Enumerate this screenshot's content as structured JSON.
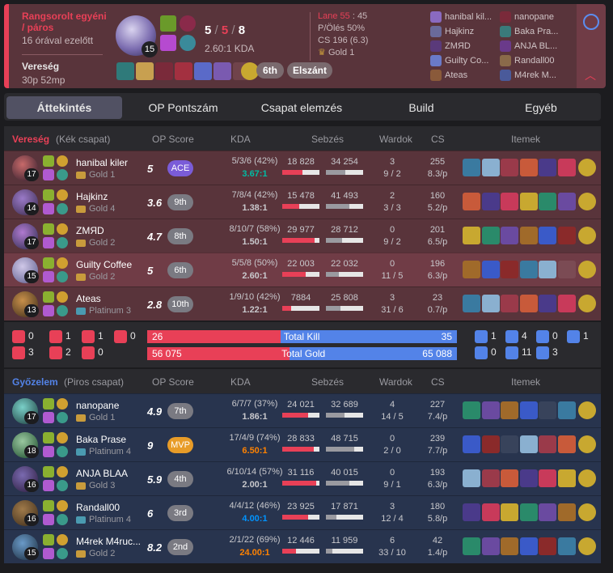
{
  "match": {
    "mode": "Rangsorolt egyéni / páros",
    "ago": "16 órával ezelőtt",
    "result": "Vereség",
    "length": "30p 52mp",
    "champ_level": "15",
    "kills": "5",
    "deaths": "5",
    "assists": "8",
    "kda_ratio": "2.60:1 KDA",
    "lane": "Lane 55",
    "lane_value": ": 45",
    "kp": "P/Ölés 50%",
    "cs": "CS 196 (6.3)",
    "rank": "Gold 1",
    "place_badge": "6th",
    "tag_badge": "Elszánt",
    "blue_players": [
      "hanibal kil...",
      "Hajkinz",
      "ZMЯD",
      "Guilty Co...",
      "Ateas"
    ],
    "red_players": [
      "nanopane",
      "Baka Pra...",
      "ANJA BL...",
      "Randall00",
      "M4rek M..."
    ]
  },
  "tabs": [
    "Áttekintés",
    "OP Pontszám",
    "Csapat elemzés",
    "Build",
    "Egyéb"
  ],
  "headers": {
    "op": "OP Score",
    "kda": "KDA",
    "dmg": "Sebzés",
    "ward": "Wardok",
    "cs": "CS",
    "items": "Itemek"
  },
  "teams": [
    {
      "result": "Vereség",
      "label": "(Kék csapat)",
      "result_color": "#e84057",
      "players": [
        {
          "name": "hanibal kiler",
          "tier": "Gold 1",
          "level": "17",
          "op": "5",
          "badge": "ACE",
          "kda": "5/3/6 (42%)",
          "ratio": "3.67:1",
          "dmg": "18 828",
          "taken": "34 254",
          "dmg_frac": 0.55,
          "taken_frac": 0.53,
          "ward": "3",
          "ward2": "9 / 2",
          "cs": "255",
          "cspm": "8.3/p"
        },
        {
          "name": "Hajkinz",
          "tier": "Gold 4",
          "level": "14",
          "op": "3.6",
          "badge": "9th",
          "kda": "7/8/4 (42%)",
          "ratio": "1.38:1",
          "dmg": "15 478",
          "taken": "41 493",
          "dmg_frac": 0.45,
          "taken_frac": 0.64,
          "ward": "2",
          "ward2": "3 / 3",
          "cs": "160",
          "cspm": "5.2/p"
        },
        {
          "name": "ZMЯD",
          "tier": "Gold 2",
          "level": "17",
          "op": "4.7",
          "badge": "8th",
          "kda": "8/10/7 (58%)",
          "ratio": "1.50:1",
          "dmg": "29 977",
          "taken": "28 712",
          "dmg_frac": 0.88,
          "taken_frac": 0.44,
          "ward": "0",
          "ward2": "9 / 2",
          "cs": "201",
          "cspm": "6.5/p"
        },
        {
          "name": "Guilty Coffee",
          "tier": "Gold 2",
          "level": "15",
          "op": "5",
          "badge": "6th",
          "kda": "5/5/8 (50%)",
          "ratio": "2.60:1",
          "dmg": "22 003",
          "taken": "22 032",
          "dmg_frac": 0.64,
          "taken_frac": 0.34,
          "ward": "0",
          "ward2": "11 / 5",
          "cs": "196",
          "cspm": "6.3/p"
        },
        {
          "name": "Ateas",
          "tier": "Platinum 3",
          "level": "13",
          "op": "2.8",
          "badge": "10th",
          "kda": "1/9/10 (42%)",
          "ratio": "1.22:1",
          "dmg": "7884",
          "taken": "25 808",
          "dmg_frac": 0.23,
          "taken_frac": 0.4,
          "ward": "3",
          "ward2": "31 / 6",
          "cs": "23",
          "cspm": "0.7/p"
        }
      ]
    },
    {
      "result": "Győzelem",
      "label": "(Piros csapat)",
      "result_color": "#5383e8",
      "players": [
        {
          "name": "nanopane",
          "tier": "Gold 1",
          "level": "17",
          "op": "4.9",
          "badge": "7th",
          "kda": "6/7/7 (37%)",
          "ratio": "1.86:1",
          "dmg": "24 021",
          "taken": "32 689",
          "dmg_frac": 0.7,
          "taken_frac": 0.5,
          "ward": "4",
          "ward2": "14 / 5",
          "cs": "227",
          "cspm": "7.4/p"
        },
        {
          "name": "Baka Prase",
          "tier": "Platinum 4",
          "level": "18",
          "op": "9",
          "badge": "MVP",
          "kda": "17/4/9 (74%)",
          "ratio": "6.50:1",
          "dmg": "28 833",
          "taken": "48 715",
          "dmg_frac": 0.84,
          "taken_frac": 0.75,
          "ward": "0",
          "ward2": "2 / 0",
          "cs": "239",
          "cspm": "7.7/p"
        },
        {
          "name": "ANJA BLAA",
          "tier": "Gold 3",
          "level": "16",
          "op": "5.9",
          "badge": "4th",
          "kda": "6/10/14 (57%)",
          "ratio": "2.00:1",
          "dmg": "31 116",
          "taken": "40 015",
          "dmg_frac": 0.91,
          "taken_frac": 0.62,
          "ward": "0",
          "ward2": "9 / 1",
          "cs": "193",
          "cspm": "6.3/p"
        },
        {
          "name": "Randall00",
          "tier": "Platinum 4",
          "level": "16",
          "op": "6",
          "badge": "3rd",
          "kda": "4/4/12 (46%)",
          "ratio": "4.00:1",
          "dmg": "23 925",
          "taken": "17 871",
          "dmg_frac": 0.7,
          "taken_frac": 0.28,
          "ward": "3",
          "ward2": "12 / 4",
          "cs": "180",
          "cspm": "5.8/p"
        },
        {
          "name": "M4rek M4ruc...",
          "tier": "Gold 2",
          "level": "15",
          "op": "8.2",
          "badge": "2nd",
          "kda": "2/1/22 (69%)",
          "ratio": "24.00:1",
          "dmg": "12 446",
          "taken": "11 959",
          "dmg_frac": 0.36,
          "taken_frac": 0.18,
          "ward": "6",
          "ward2": "33 / 10",
          "cs": "42",
          "cspm": "1.4/p"
        }
      ]
    }
  ],
  "objectives": {
    "blue": [
      "0",
      "1",
      "1",
      "0",
      "3",
      "2",
      "0"
    ],
    "red": [
      "1",
      "4",
      "0",
      "1",
      "0",
      "11",
      "3"
    ],
    "kill_red": "26",
    "kill_label": "Total Kill",
    "kill_blue": "35",
    "kill_red_frac": 0.43,
    "gold_red": "56 075",
    "gold_label": "Total Gold",
    "gold_blue": "65 088",
    "gold_red_frac": 0.46
  },
  "colors": {
    "loss": "#e84057",
    "win": "#5383e8",
    "loss_row": "#59343b",
    "loss_row_alt": "#703c46",
    "win_row": "#28344e",
    "win_row_alt": "#2f436e",
    "mvp": "#e89c28",
    "ace": "#7a5cd8"
  }
}
